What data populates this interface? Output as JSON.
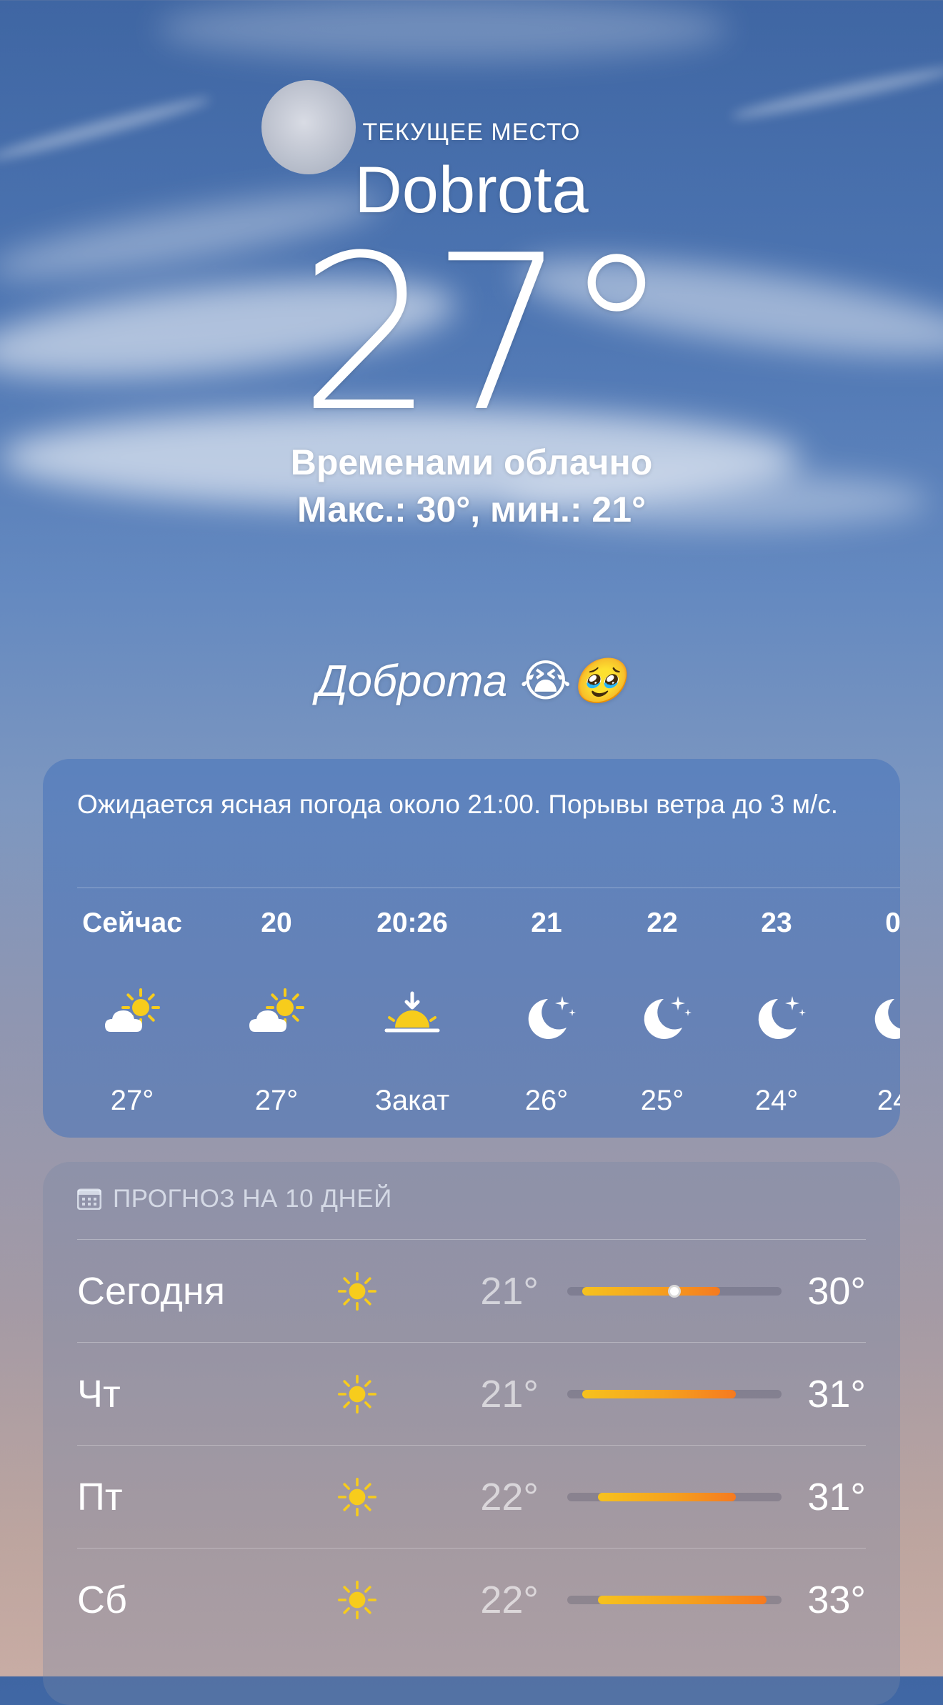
{
  "header": {
    "location_label": "ТЕКУЩЕЕ МЕСТО",
    "city": "Dobrota",
    "temperature": "27°",
    "condition": "Временами облачно",
    "minmax": "Макс.: 30°, мин.: 21°",
    "subtitle": "Доброта 😭🥹"
  },
  "hourly": {
    "summary": "Ожидается ясная погода около 21:00. Порывы ветра до 3 м/с.",
    "items": [
      {
        "time": "Сейчас",
        "icon": "partly-cloudy-sun-icon",
        "temp": "27°"
      },
      {
        "time": "20",
        "icon": "partly-cloudy-sun-icon",
        "temp": "27°"
      },
      {
        "time": "20:26",
        "icon": "sunset-icon",
        "temp": "Закат"
      },
      {
        "time": "21",
        "icon": "moon-stars-icon",
        "temp": "26°"
      },
      {
        "time": "22",
        "icon": "moon-stars-icon",
        "temp": "25°"
      },
      {
        "time": "23",
        "icon": "moon-stars-icon",
        "temp": "24°"
      },
      {
        "time": "0",
        "icon": "moon-stars-icon",
        "temp": "24"
      }
    ]
  },
  "daily": {
    "heading": "ПРОГНОЗ НА 10 ДНЕЙ",
    "scale": {
      "min": 20,
      "max": 34
    },
    "current_temp": 27,
    "days": [
      {
        "name": "Сегодня",
        "icon": "sun-icon",
        "low": "21°",
        "high": "30°",
        "low_val": 21,
        "high_val": 30,
        "current": true
      },
      {
        "name": "Чт",
        "icon": "sun-icon",
        "low": "21°",
        "high": "31°",
        "low_val": 21,
        "high_val": 31
      },
      {
        "name": "Пт",
        "icon": "sun-icon",
        "low": "22°",
        "high": "31°",
        "low_val": 22,
        "high_val": 31
      },
      {
        "name": "Сб",
        "icon": "sun-icon",
        "low": "22°",
        "high": "33°",
        "low_val": 22,
        "high_val": 33
      }
    ]
  },
  "colors": {
    "sun": "#f7cc1c",
    "bar_start": "#f6c21e",
    "bar_end": "#f57a20"
  }
}
